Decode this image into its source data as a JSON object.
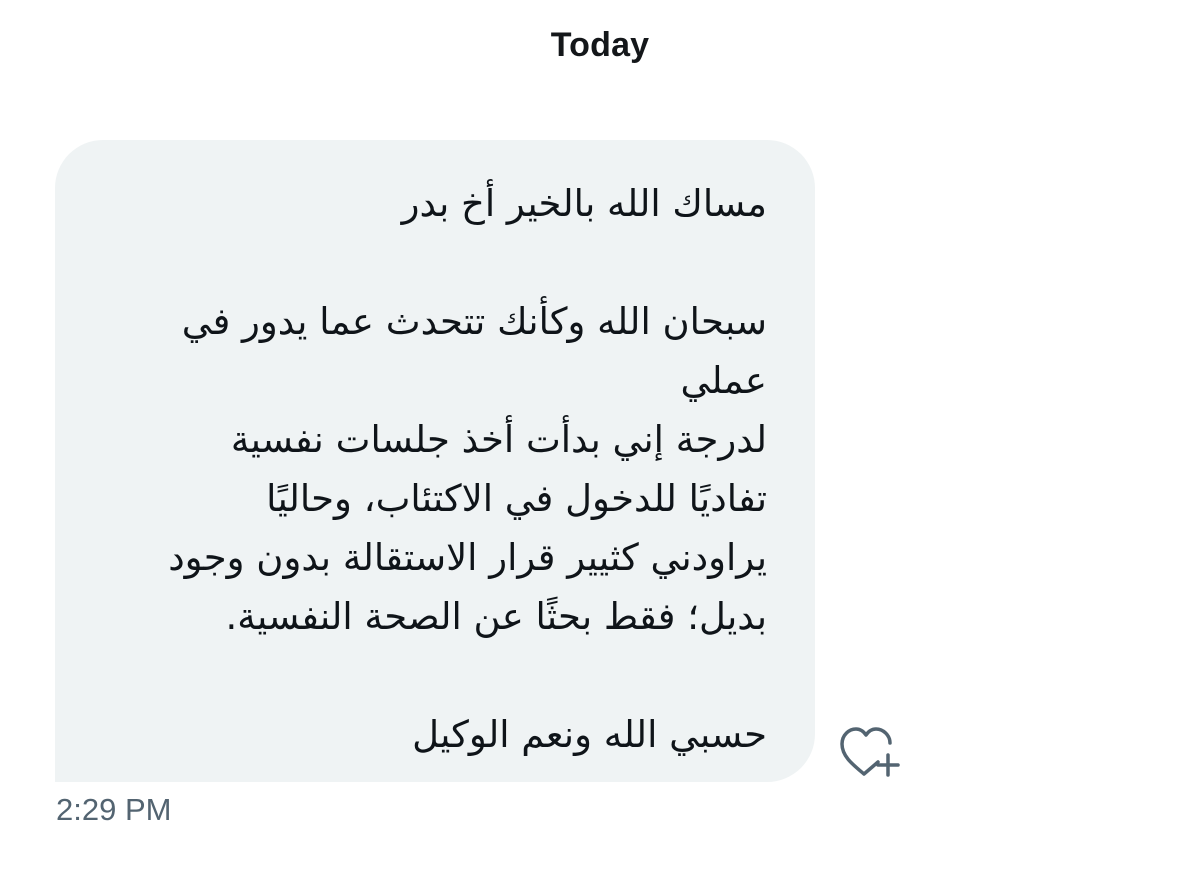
{
  "header": {
    "date_label": "Today"
  },
  "message": {
    "lines": [
      "مساك الله بالخير أخ بدر",
      "",
      "سبحان الله وكأنك تتحدث عما يدور في",
      "عملي",
      "لدرجة إني بدأت أخذ جلسات نفسية",
      "تفاديًا للدخول في الاكتئاب، وحاليًا",
      "يراودني كثيير قرار الاستقالة بدون وجود",
      "بديل؛ فقط بحثًا عن الصحة النفسية.",
      "",
      "حسبي الله ونعم الوكيل"
    ],
    "timestamp": "2:29 PM"
  },
  "actions": {
    "react_icon": "heart-plus-icon"
  },
  "colors": {
    "bubble_bg": "#eff3f4",
    "text": "#0f1419",
    "timestamp": "#536471",
    "icon": "#536471"
  }
}
